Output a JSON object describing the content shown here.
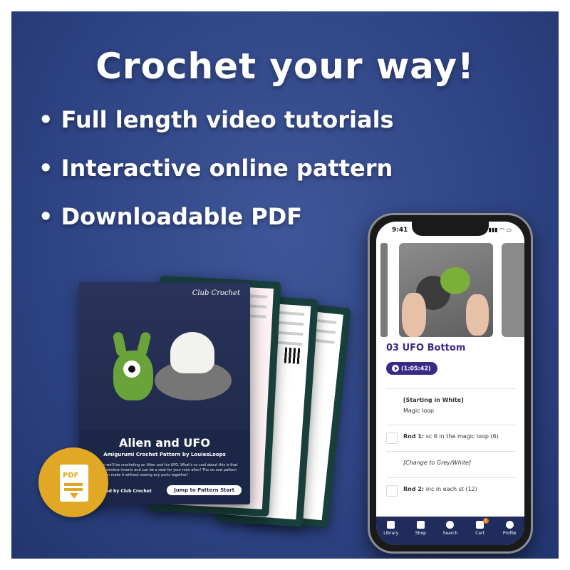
{
  "headline": "Crochet your way!",
  "bullets": [
    "• Full length video tutorials",
    "• Interactive online pattern",
    "• Downloadable PDF"
  ],
  "pattern_cover": {
    "brand": "Club Crochet",
    "title": "Alien and UFO",
    "subtitle": "Amigurumi Crochet Pattern by LouiesLoops",
    "description": "...lesson we'll be crocheting an Alien and his UFO. What's so cool about this is that the UFO window inverts and can be a seat for your mini alien! The no sew pattern so you can make it without sewing any parts together!",
    "produced_by": "Produced by Club Crochet",
    "jump_button": "Jump to Pattern Start"
  },
  "pdf_badge": {
    "label": "PDF"
  },
  "phone": {
    "time": "9:41",
    "status_icons": "▮▮▮ ◠ ▭",
    "lesson_title": "03  UFO Bottom",
    "video_duration": "(1:05:42)",
    "rows": [
      {
        "heading": "[Starting in White]",
        "text": "Magic loop"
      },
      {
        "label": "Rnd 1:",
        "text": "sc 6 in the magic loop (6)"
      },
      {
        "text": "[Change to Grey/White]"
      },
      {
        "label": "Rnd 2:",
        "text": "inc in each st (12)"
      }
    ],
    "tabs": [
      {
        "label": "Library",
        "icon": "book-icon"
      },
      {
        "label": "Shop",
        "icon": "bag-icon"
      },
      {
        "label": "Search",
        "icon": "search-icon"
      },
      {
        "label": "Cart",
        "icon": "cart-icon",
        "badge": "1"
      },
      {
        "label": "Profile",
        "icon": "profile-icon"
      }
    ]
  },
  "colors": {
    "background": "#2f4585",
    "accent_purple": "#3a2a86",
    "pdf_gold": "#e0a824",
    "tabbar": "#1f2c5c"
  }
}
